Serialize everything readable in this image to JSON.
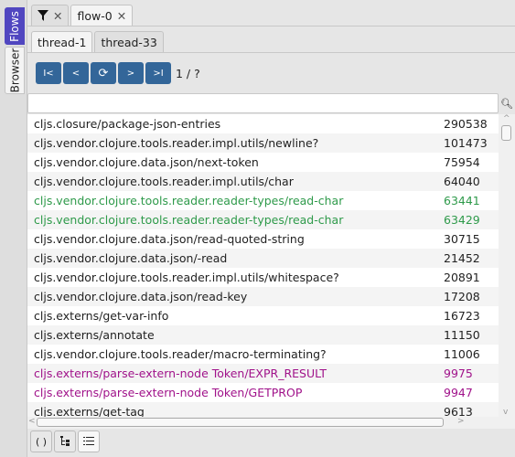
{
  "sidebar": {
    "tabs": [
      {
        "label": "Flows",
        "active": true
      },
      {
        "label": "Browser"
      }
    ]
  },
  "top_tabs": {
    "filter_icon": "filter-icon",
    "flow_tab": "flow-0",
    "close": "✕"
  },
  "thread_tabs": [
    "thread-1",
    "thread-33"
  ],
  "nav": {
    "first": "I<",
    "prev": "<",
    "refresh": "⟳",
    "next": ">",
    "last": ">I",
    "page": "1 / ?"
  },
  "search": {
    "value": "",
    "placeholder": ""
  },
  "colors": {
    "accent": "#5046c0",
    "button": "#336699",
    "green": "#2e9a4a",
    "magenta": "#a0128a"
  },
  "rows": [
    {
      "name": "cljs.closure/package-json-entries",
      "count": "290538",
      "color": "#222"
    },
    {
      "name": "cljs.vendor.clojure.tools.reader.impl.utils/newline?",
      "count": "101473",
      "color": "#222"
    },
    {
      "name": "cljs.vendor.clojure.data.json/next-token",
      "count": "75954",
      "color": "#222"
    },
    {
      "name": "cljs.vendor.clojure.tools.reader.impl.utils/char",
      "count": "64040",
      "color": "#222"
    },
    {
      "name": "cljs.vendor.clojure.tools.reader.reader-types/read-char",
      "count": "63441",
      "color": "#2e9a4a"
    },
    {
      "name": "cljs.vendor.clojure.tools.reader.reader-types/read-char",
      "count": "63429",
      "color": "#2e9a4a"
    },
    {
      "name": "cljs.vendor.clojure.data.json/read-quoted-string",
      "count": "30715",
      "color": "#222"
    },
    {
      "name": "cljs.vendor.clojure.data.json/-read",
      "count": "21452",
      "color": "#222"
    },
    {
      "name": "cljs.vendor.clojure.tools.reader.impl.utils/whitespace?",
      "count": "20891",
      "color": "#222"
    },
    {
      "name": "cljs.vendor.clojure.data.json/read-key",
      "count": "17208",
      "color": "#222"
    },
    {
      "name": "cljs.externs/get-var-info",
      "count": "16723",
      "color": "#222"
    },
    {
      "name": "cljs.externs/annotate",
      "count": "11150",
      "color": "#222"
    },
    {
      "name": "cljs.vendor.clojure.tools.reader/macro-terminating?",
      "count": "11006",
      "color": "#222"
    },
    {
      "name": "cljs.externs/parse-extern-node Token/EXPR_RESULT",
      "count": "9975",
      "color": "#a0128a"
    },
    {
      "name": "cljs.externs/parse-extern-node Token/GETPROP",
      "count": "9947",
      "color": "#a0128a"
    },
    {
      "name": "cljs.externs/get-tag",
      "count": "9613",
      "color": "#222"
    }
  ],
  "bottom": {
    "code": "( )",
    "tree": "tree-icon",
    "list": "list-icon"
  }
}
